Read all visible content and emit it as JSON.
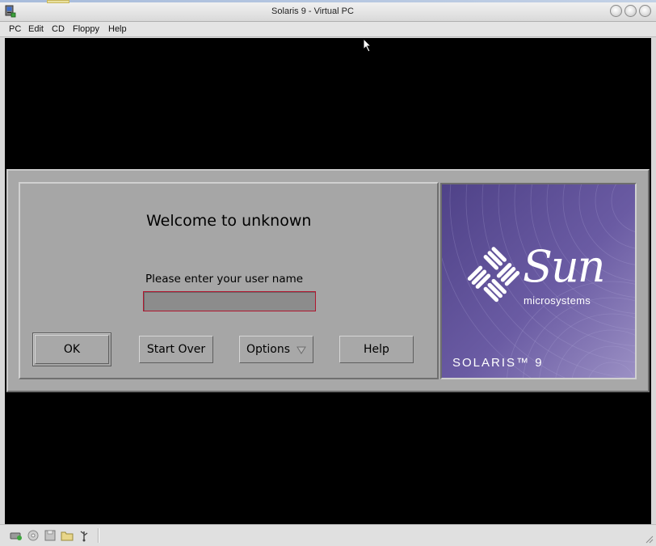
{
  "window": {
    "title": "Solaris 9 - Virtual PC",
    "controls": [
      "minimize-icon",
      "zoom-icon",
      "close-icon"
    ]
  },
  "menu": {
    "items": [
      {
        "label": "PC"
      },
      {
        "label": "Edit"
      },
      {
        "label": "CD"
      },
      {
        "label": "Floppy"
      },
      {
        "label": "Help"
      }
    ]
  },
  "login": {
    "welcome": "Welcome to unknown",
    "prompt": "Please enter your user name",
    "username_value": "",
    "buttons": {
      "ok": "OK",
      "start_over": "Start Over",
      "options": "Options",
      "help": "Help"
    }
  },
  "branding": {
    "brand": "Sun",
    "brand_sub": "microsystems",
    "product": "SOLARIS™ 9",
    "panel_color": "#5e4f95"
  },
  "statusbar": {
    "icons": [
      "network-icon",
      "cd-icon",
      "floppy-icon",
      "shared-folder-icon",
      "usb-icon"
    ]
  }
}
